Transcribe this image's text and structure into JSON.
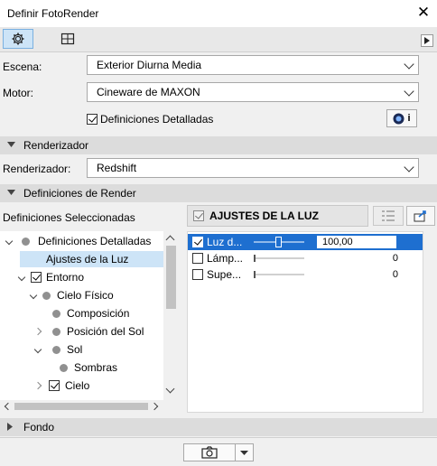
{
  "window": {
    "title": "Definir FotoRender"
  },
  "toolbar": {
    "tabs": [
      {
        "icon": "gear-icon",
        "active": true
      },
      {
        "icon": "crop-frame-icon",
        "active": false
      }
    ]
  },
  "scene": {
    "label": "Escena:",
    "value": "Exterior Diurna Media"
  },
  "engine": {
    "label": "Motor:",
    "value": "Cineware de MAXON"
  },
  "detailed": {
    "label": "Definiciones Detalladas",
    "checked": true,
    "info_glyph": "i"
  },
  "renderer_section": {
    "title": "Renderizador"
  },
  "renderer": {
    "label": "Renderizador:",
    "value": "Redshift"
  },
  "render_defs_section": {
    "title": "Definiciones de Render"
  },
  "selected_label": "Definiciones Seleccionadas",
  "tree": [
    {
      "label": "Definiciones Detalladas"
    },
    {
      "label": "Ajustes de la Luz"
    },
    {
      "label": "Entorno"
    },
    {
      "label": "Cielo Físico"
    },
    {
      "label": "Composición"
    },
    {
      "label": "Posición del Sol"
    },
    {
      "label": "Sol"
    },
    {
      "label": "Sombras"
    },
    {
      "label": "Cielo"
    }
  ],
  "panel": {
    "header": "AJUSTES DE LA LUZ",
    "rows": [
      {
        "label": "Luz d...",
        "value": "100,00",
        "checked": true,
        "level": 0.5
      },
      {
        "label": "Lámp...",
        "value": "0",
        "checked": false,
        "level": 0
      },
      {
        "label": "Supe...",
        "value": "0",
        "checked": false,
        "level": 0
      }
    ]
  },
  "fondo_section": {
    "title": "Fondo"
  },
  "colors": {
    "selection": "#1e6fd0",
    "tree_selected": "#cde4f7",
    "section_bg": "#dcdcdc"
  }
}
